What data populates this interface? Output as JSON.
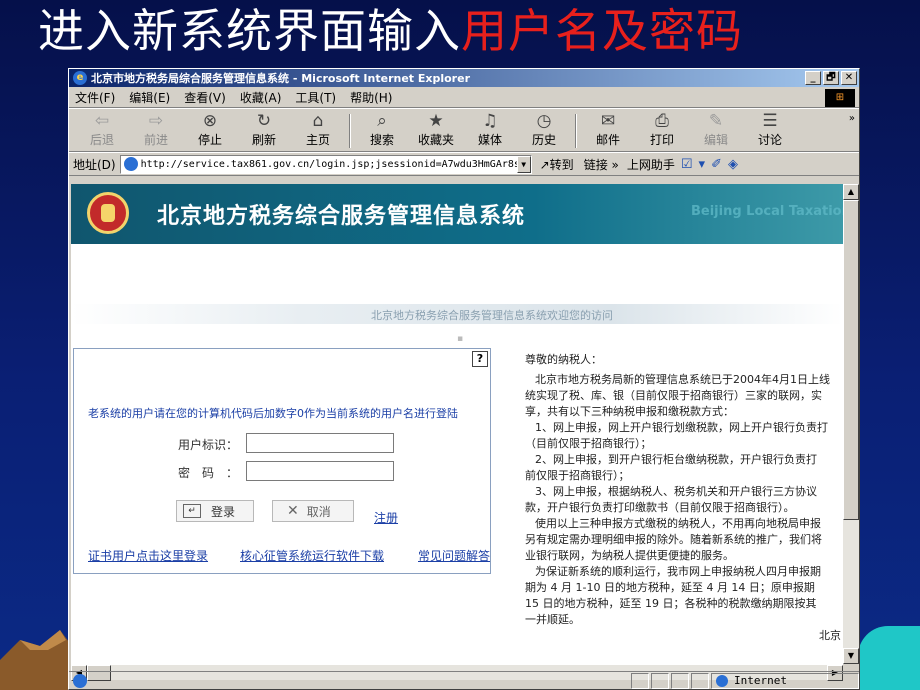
{
  "slide": {
    "title_white": "进入新系统界面输入",
    "title_red": "用户名及密码",
    "colors": {
      "title_white": "#ffffff",
      "title_red": "#e8201c",
      "slide_bg": "#0a1f74"
    }
  },
  "browser": {
    "window_title": "北京市地方税务局综合服务管理信息系统 - Microsoft Internet Explorer",
    "window_buttons": [
      "_",
      "🗗",
      "✕"
    ],
    "menu": [
      "文件(F)",
      "编辑(E)",
      "查看(V)",
      "收藏(A)",
      "工具(T)",
      "帮助(H)"
    ],
    "toolbar": [
      {
        "label": "后退",
        "icon": "back-arrow-icon",
        "enabled": false
      },
      {
        "label": "前进",
        "icon": "forward-arrow-icon",
        "enabled": false
      },
      {
        "label": "停止",
        "icon": "stop-icon",
        "enabled": true
      },
      {
        "label": "刷新",
        "icon": "refresh-icon",
        "enabled": true
      },
      {
        "label": "主页",
        "icon": "home-icon",
        "enabled": true
      },
      {
        "label": "搜索",
        "icon": "search-icon",
        "enabled": true
      },
      {
        "label": "收藏夹",
        "icon": "favorites-icon",
        "enabled": true
      },
      {
        "label": "媒体",
        "icon": "media-icon",
        "enabled": true
      },
      {
        "label": "历史",
        "icon": "history-icon",
        "enabled": true
      },
      {
        "label": "邮件",
        "icon": "mail-icon",
        "enabled": true
      },
      {
        "label": "打印",
        "icon": "print-icon",
        "enabled": true
      },
      {
        "label": "编辑",
        "icon": "edit-icon",
        "enabled": false
      },
      {
        "label": "讨论",
        "icon": "discuss-icon",
        "enabled": true
      }
    ],
    "address_label": "地址(D)",
    "url": "http://service.tax861.gov.cn/login.jsp;jsessionid=A7wdu3HmGAr8s",
    "goto_label": "转到",
    "links_label": "链接 »",
    "helper_label": "上网助手",
    "status_zone": "Internet"
  },
  "page": {
    "banner_title": "北京地方税务综合服务管理信息系统",
    "banner_en": "Beijing Local Taxation",
    "welcome": "北京地方税务综合服务管理信息系统欢迎您的访问",
    "login": {
      "help": "?",
      "note": "老系统的用户请在您的计算机代码后加数字0作为当前系统的用户名进行登陆",
      "user_label": "用户标识：",
      "pwd_label": "密码：",
      "user_value": "",
      "pwd_value": "",
      "login_button": "登录",
      "cancel_button": "取消",
      "register_link": "注册",
      "links": [
        "证书用户点击这里登录",
        "核心征管系统运行软件下载",
        "常见问题解答"
      ]
    },
    "info": {
      "salutation": "尊敬的纳税人：",
      "lines": [
        "北京市地方税务局新的管理信息系统已于2004年4月1日上线",
        "统实现了税、库、银（目前仅限于招商银行）三家的联网，实",
        "享，共有以下三种纳税申报和缴税款方式：",
        "1、网上申报，网上开户银行划缴税款，网上开户银行负责打",
        "（目前仅限于招商银行）；",
        "2、网上申报，到开户银行柜台缴纳税款，开户银行负责打",
        "前仅限于招商银行）；",
        "3、网上申报，根据纳税人、税务机关和开户银行三方协议",
        "款，开户银行负责打印缴款书（目前仅限于招商银行）。",
        "使用以上三种申报方式缴税的纳税人，不用再向地税局申报",
        "另有规定需办理明细申报的除外。随着新系统的推广，我们将",
        "业银行联网，为纳税人提供更便捷的服务。",
        "为保证新系统的顺利运行，我市网上申报纳税人四月申报期",
        "期为 4 月 1-10 日的地方税种，延至 4 月 14 日；原申报期",
        "15 日的地方税种，延至 19 日；各税种的税款缴纳期限按其",
        "一并顺延。",
        "北京"
      ],
      "indented": [
        3,
        5,
        7
      ]
    }
  }
}
